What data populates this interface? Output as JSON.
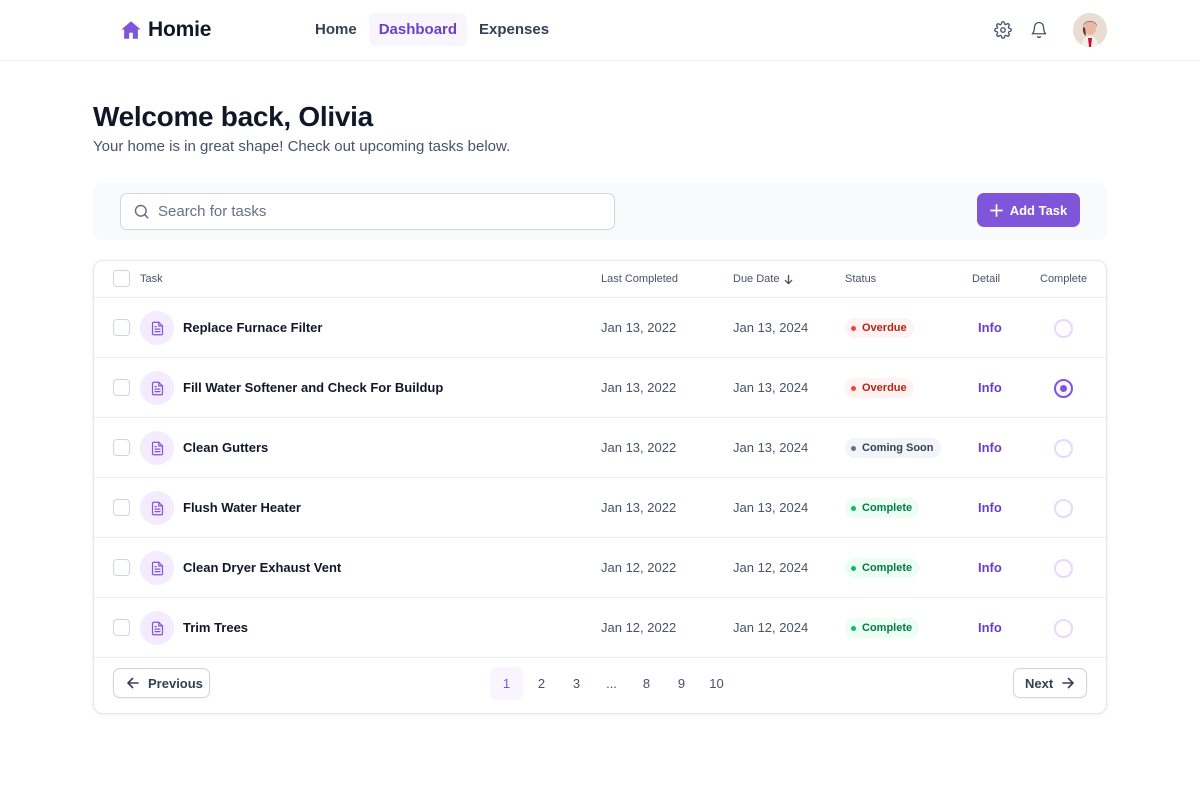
{
  "app": {
    "name": "Homie"
  },
  "nav": {
    "links": [
      {
        "label": "Home",
        "active": false
      },
      {
        "label": "Dashboard",
        "active": true
      },
      {
        "label": "Expenses",
        "active": false
      }
    ],
    "icons": [
      "gear-icon",
      "bell-icon",
      "avatar"
    ]
  },
  "header": {
    "title": "Welcome back, Olivia",
    "subtitle": "Your home is in great shape! Check out upcoming tasks below."
  },
  "toolbar": {
    "search_placeholder": "Search for tasks",
    "search_value": "",
    "add_label": "Add Task"
  },
  "table": {
    "columns": {
      "task": "Task",
      "last_completed": "Last Completed",
      "due_date": "Due Date",
      "status": "Status",
      "detail": "Detail",
      "complete": "Complete"
    },
    "info_label": "Info",
    "rows": [
      {
        "task": "Replace Furnace Filter",
        "last_completed": "Jan 13, 2022",
        "due_date": "Jan 13, 2024",
        "status": "Overdue",
        "status_kind": "overdue",
        "detail": "Info",
        "complete_selected": false
      },
      {
        "task": "Fill Water Softener and Check For Buildup",
        "last_completed": "Jan 13, 2022",
        "due_date": "Jan 13, 2024",
        "status": "Overdue",
        "status_kind": "overdue",
        "detail": "Info",
        "complete_selected": true
      },
      {
        "task": "Clean Gutters",
        "last_completed": "Jan 13, 2022",
        "due_date": "Jan 13, 2024",
        "status": "Coming Soon",
        "status_kind": "soon",
        "detail": "Info",
        "complete_selected": false
      },
      {
        "task": "Flush Water Heater",
        "last_completed": "Jan 13, 2022",
        "due_date": "Jan 13, 2024",
        "status": "Complete",
        "status_kind": "complete",
        "detail": "Info",
        "complete_selected": false
      },
      {
        "task": "Clean Dryer Exhaust Vent",
        "last_completed": "Jan 12, 2022",
        "due_date": "Jan 12, 2024",
        "status": "Complete",
        "status_kind": "complete",
        "detail": "Info",
        "complete_selected": false
      },
      {
        "task": "Trim Trees",
        "last_completed": "Jan 12, 2022",
        "due_date": "Jan 12, 2024",
        "status": "Complete",
        "status_kind": "complete",
        "detail": "Info",
        "complete_selected": false
      }
    ]
  },
  "pagination": {
    "previous_label": "Previous",
    "next_label": "Next",
    "pages": [
      "1",
      "2",
      "3",
      "...",
      "8",
      "9",
      "10"
    ],
    "current": "1"
  },
  "colors": {
    "accent": "#7f56d9",
    "overdue_bg": "#fef3f2",
    "overdue_text": "#b42318",
    "overdue_dot": "#f04438",
    "soon_bg": "#f2f4f7",
    "soon_text": "#344054",
    "soon_dot": "#667085",
    "complete_bg": "#ecfdf3",
    "complete_text": "#027a48",
    "complete_dot": "#12b76a"
  }
}
